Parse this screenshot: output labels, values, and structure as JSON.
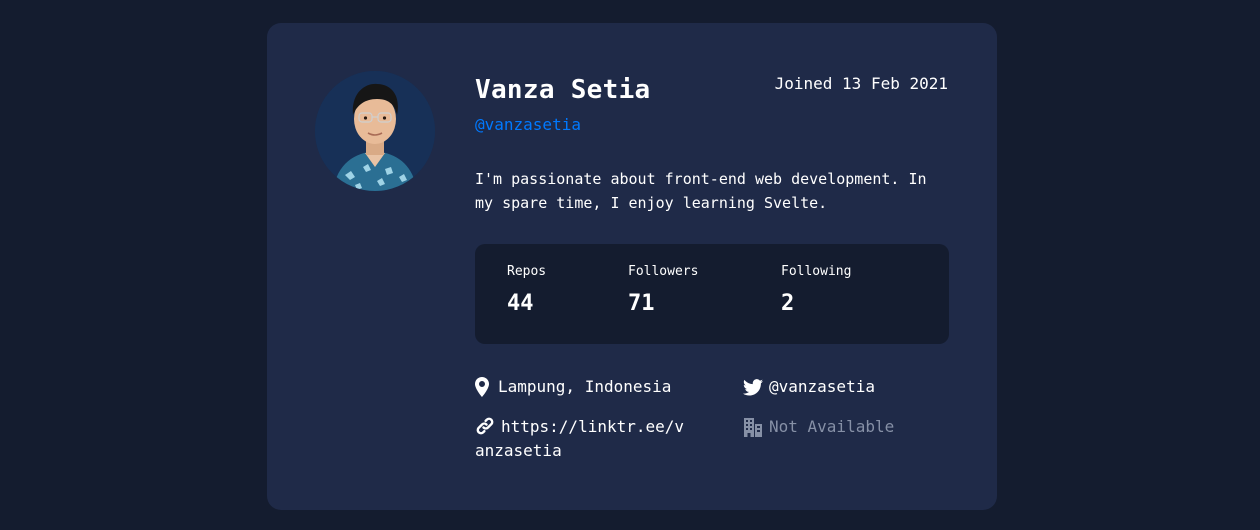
{
  "profile": {
    "name": "Vanza Setia",
    "login": "@vanzasetia",
    "joined": "Joined 13 Feb 2021",
    "bio": "I'm passionate about front-end web development. In my spare time, I enjoy learning Svelte."
  },
  "stats": {
    "repos_label": "Repos",
    "repos_value": "44",
    "followers_label": "Followers",
    "followers_value": "71",
    "following_label": "Following",
    "following_value": "2"
  },
  "links": {
    "location": "Lampung, Indonesia",
    "location_icon": "location-pin-icon",
    "twitter": "@vanzasetia",
    "twitter_icon": "twitter-icon",
    "blog": "https://linktr.ee/vanzasetia",
    "blog_icon": "link-icon",
    "company": "Not Available",
    "company_icon": "building-icon"
  },
  "colors": {
    "page_bg": "#141c2f",
    "card_bg": "#1f2a48",
    "accent": "#0079ff",
    "muted": "#8690a6"
  }
}
